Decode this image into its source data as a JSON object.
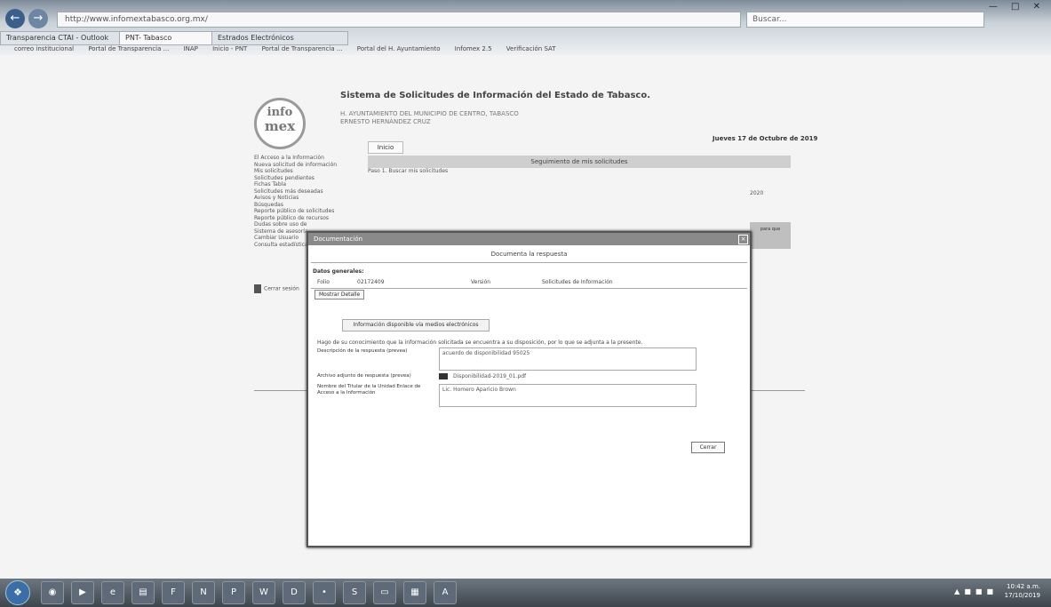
{
  "browser": {
    "address": "http://www.infomextabasco.org.mx/",
    "search_placeholder": "Buscar...",
    "tabs": [
      {
        "label": "Transparencia CTAI - Outlook"
      },
      {
        "label": "PNT- Tabasco"
      },
      {
        "label": "Estrados Electrónicos"
      }
    ],
    "favorites": [
      "correo institucional",
      "Portal de Transparencia ...",
      "INAP",
      "Inicio - PNT",
      "Portal de Transparencia ...",
      "Portal del H. Ayuntamiento",
      "Infomex 2.5",
      "Verificación SAT"
    ]
  },
  "page": {
    "logo_top": "info",
    "logo_bottom": "mex",
    "system_title": "Sistema de Solicitudes de Información del Estado de Tabasco.",
    "entity_line1": "H. AYUNTAMIENTO DEL MUNICIPIO DE CENTRO, TABASCO",
    "entity_line2": "ERNESTO HERNÁNDEZ CRUZ",
    "date": "Jueves 17 de Octubre de 2019",
    "inicio": "Inicio",
    "header_bar": "Seguimiento de mis solicitudes",
    "step": "Paso 1. Buscar mis solicitudes",
    "nav": [
      "El Acceso a la Información",
      "Nueva solicitud de información",
      "Mis solicitudes",
      "Solicitudes pendientes",
      "Fichas Tabla",
      "Solicitudes más deseadas",
      "Avisos y Noticias",
      "Búsquedas",
      "Reporte público de solicitudes",
      "Reporte público de recursos",
      "Dudas sobre uso de",
      "Sistema de asesoría",
      "Cambiar Usuario",
      "Consulta estadística"
    ],
    "close_session": "Cerrar sesión",
    "side_small": "a",
    "side_grey": "para que",
    "date_small": "2020"
  },
  "modal": {
    "title": "Documentación",
    "subtitle": "Documenta la respuesta",
    "general_label": "Datos generales:",
    "folio_label": "Folio",
    "folio_value": "02172409",
    "version_label": "Versión",
    "version_value": "Solicitudes de Información",
    "detalle_button": "Mostrar Detalle",
    "info_tab": "Información disponible vía medios electrónicos",
    "paragraph": "Hago de su conocimiento que la información solicitada se encuentra a su disposición, por lo que se adjunta a la presente.",
    "desc_label": "Descripción de la respuesta (prevea)",
    "desc_value": "acuerdo de disponibilidad 95025",
    "attach_label": "Archivo adjunto de respuesta (prevea)",
    "attach_file": "Disponibilidad-2019_01.pdf",
    "titular_label": "Nombre del Titular de la Unidad Enlace de Acceso a la Información",
    "titular_value": "Lic. Homero Aparicio Brown",
    "close_button": "Cerrar"
  },
  "taskbar": {
    "time": "10:42 a.m.",
    "date": "17/10/2019"
  }
}
